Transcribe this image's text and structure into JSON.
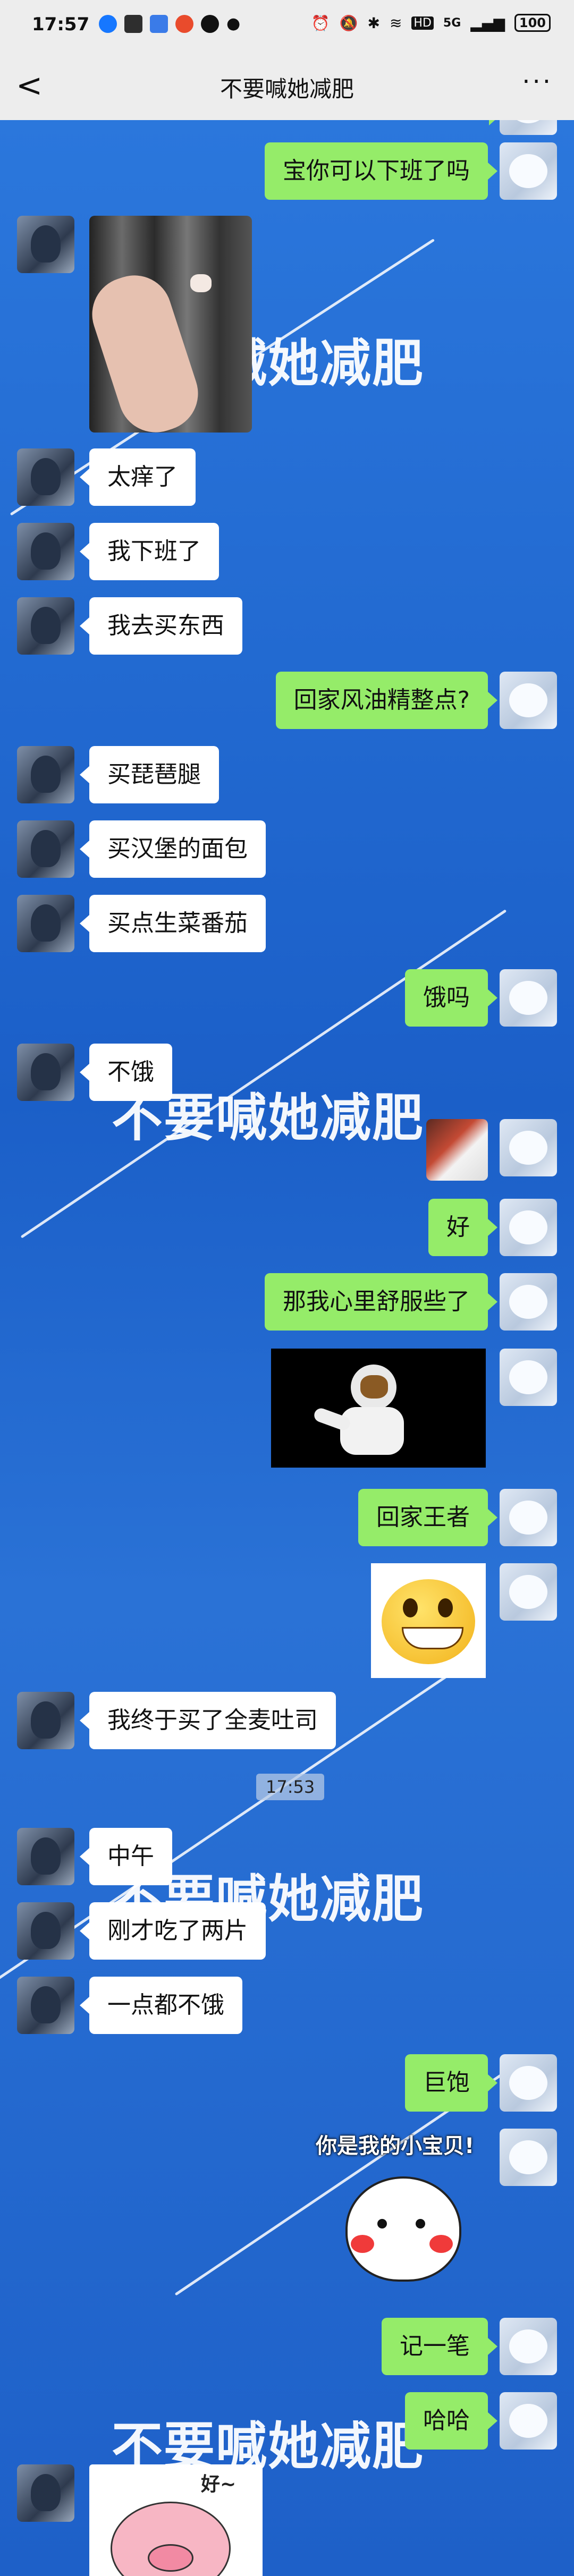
{
  "status_bar": {
    "time": "17:57",
    "battery": "100",
    "network": "5G",
    "hd": "HD"
  },
  "nav": {
    "back_label": "<",
    "title": "不要喊她减肥",
    "more_label": "···"
  },
  "watermark_text": "不要喊她减肥",
  "messages": [
    {
      "side": "out",
      "text": "宝你可以下班了吗"
    },
    {
      "side": "in",
      "type": "image",
      "desc": "photo-hand"
    },
    {
      "side": "in",
      "text": "太痒了"
    },
    {
      "side": "in",
      "text": "我下班了"
    },
    {
      "side": "in",
      "text": "我去买东西"
    },
    {
      "side": "out",
      "text": "回家风油精整点?"
    },
    {
      "side": "in",
      "text": "买琵琶腿"
    },
    {
      "side": "in",
      "text": "买汉堡的面包"
    },
    {
      "side": "in",
      "text": "买点生菜番茄"
    },
    {
      "side": "out",
      "text": "饿吗"
    },
    {
      "side": "in",
      "text": "不饿"
    },
    {
      "side": "out",
      "type": "image",
      "desc": "sticker-small"
    },
    {
      "side": "out",
      "text": "好"
    },
    {
      "side": "out",
      "text": "那我心里舒服些了"
    },
    {
      "side": "out",
      "type": "image",
      "desc": "astronaut-sticker"
    },
    {
      "side": "out",
      "text": "回家王者"
    },
    {
      "side": "out",
      "type": "image",
      "desc": "grin-emoji-sticker"
    },
    {
      "side": "in",
      "text": "我终于买了全麦吐司"
    },
    {
      "type": "time",
      "text": "17:53"
    },
    {
      "side": "in",
      "text": "中午"
    },
    {
      "side": "in",
      "text": "刚才吃了两片"
    },
    {
      "side": "in",
      "text": "一点都不饿"
    },
    {
      "side": "out",
      "text": "巨饱"
    },
    {
      "side": "out",
      "type": "image",
      "desc": "bear-sticker",
      "caption": "你是我的小宝贝!"
    },
    {
      "side": "out",
      "text": "记一笔"
    },
    {
      "side": "out",
      "text": "哈哈"
    },
    {
      "side": "in",
      "type": "image",
      "desc": "pig-sticker",
      "caption": "好~"
    }
  ],
  "colors": {
    "bubble_out": "#95ec69",
    "bubble_in": "#ffffff",
    "bg_blue": "#1f63c9"
  }
}
